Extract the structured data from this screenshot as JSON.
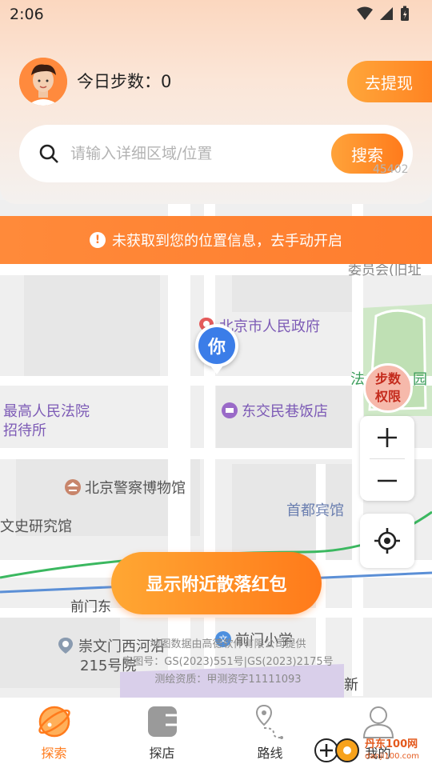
{
  "status_bar": {
    "time": "2:06"
  },
  "header": {
    "steps_label": "今日步数：0",
    "withdraw_label": "去提现"
  },
  "search": {
    "placeholder": "请输入详细区域/位置",
    "button_label": "搜索"
  },
  "location_banner": {
    "text": "未获取到您的位置信息，去手动开启"
  },
  "map": {
    "partial_text_top": "45402",
    "partial_label_committee": "委员会(旧址",
    "me_marker_label": "你",
    "steps_permission_label": "步数权限",
    "pois": {
      "beijing_gov": "北京市人民政府",
      "supreme_court_1": "最高人民法院",
      "supreme_court_2": "招待所",
      "dongjiao_hotel": "东交民巷饭店",
      "police_museum": "北京警察博物馆",
      "capital_hotel": "首都宾馆",
      "history_institute": "文史研究馆",
      "qianmen_school": "前门小学",
      "chongwen_1": "崇文门西河沿",
      "chongwen_2": "215号院",
      "court_fragment": "法",
      "garden_fragment": "园",
      "qianmen_road": "前门东",
      "new_fragment": "新"
    },
    "copyright_lines": [
      "地图数据由高德软件有限公司提供",
      "审图号：GS(2023)551号|GS(2023)2175号",
      "测绘资质：甲测资字11111093"
    ],
    "redpacket_button": "显示附近散落红包"
  },
  "bottom_nav": [
    {
      "label": "探索",
      "icon": "explore-icon",
      "active": true
    },
    {
      "label": "探店",
      "icon": "shop-icon",
      "active": false
    },
    {
      "label": "路线",
      "icon": "route-icon",
      "active": false
    },
    {
      "label": "我的",
      "icon": "profile-icon",
      "active": false
    }
  ],
  "watermark": {
    "line1": "丹东100网",
    "line2": "danji100.com"
  },
  "colors": {
    "accent": "#ff7b1c",
    "banner": "#ff8a3a",
    "marker_blue": "#3b7de8"
  }
}
